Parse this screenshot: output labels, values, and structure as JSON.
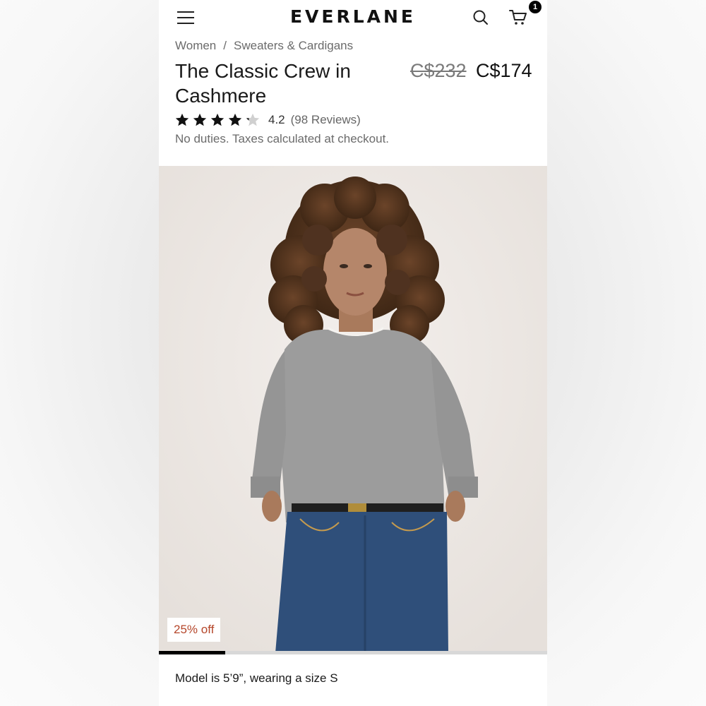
{
  "header": {
    "logo": "EVERLANE",
    "cart_count": "1"
  },
  "breadcrumb": {
    "items": [
      "Women",
      "Sweaters & Cardigans"
    ],
    "separator": "/"
  },
  "product": {
    "title": "The Classic Crew in Cashmere",
    "price_original": "C$232",
    "price_sale": "C$174",
    "rating": 4.2,
    "rating_text": "4.2",
    "reviews_text": "(98 Reviews)",
    "duties_note": "No duties. Taxes calculated at checkout."
  },
  "gallery": {
    "discount_badge": "25% off",
    "progress_fraction": 0.17,
    "caption": "Model is 5’9”, wearing a size S"
  },
  "colors": {
    "discount_text": "#b5462a",
    "star_filled": "#111111",
    "star_empty": "#d0d0d0",
    "sweater": "#9a9a9a",
    "jeans": "#2f4f7a",
    "hair": "#5a3a24"
  },
  "icons": [
    "hamburger-menu-icon",
    "search-icon",
    "cart-icon",
    "star-icon"
  ]
}
